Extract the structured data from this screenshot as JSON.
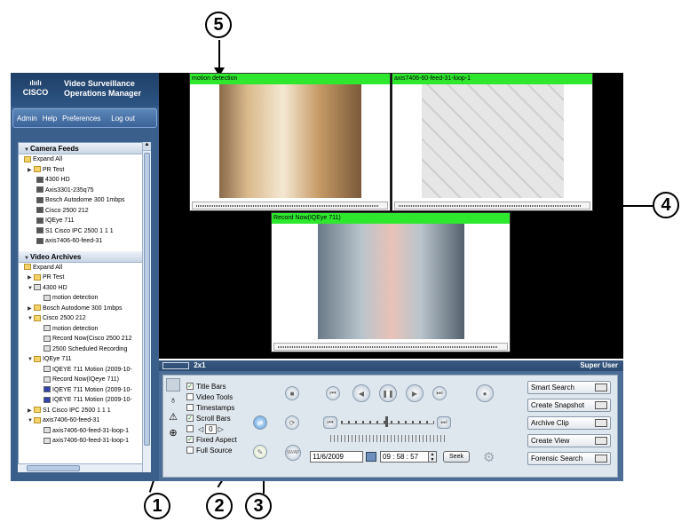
{
  "callouts": [
    "5",
    "4",
    "1",
    "2",
    "3"
  ],
  "brand": {
    "logo_bars": "ılıılı",
    "logo_text": "CISCO",
    "title_line1": "Video Surveillance",
    "title_line2": "Operations Manager"
  },
  "topnav": [
    "Admin",
    "Help",
    "Preferences",
    "Log out"
  ],
  "camera_feeds": {
    "header": "Camera Feeds",
    "items": [
      "Expand All",
      "PR Test",
      "4300 HD",
      "Axis3301-235q75",
      "Bosch Autodome 300 1mbps",
      "Cisco 2500 212",
      "IQEye 711",
      "S1 Cisco IPC 2500 1 1 1",
      "axis7406-60-feed-31"
    ]
  },
  "video_archives": {
    "header": "Video Archives",
    "items": [
      "Expand All",
      "PR Test",
      "4300 HD",
      "motion detection",
      "Bosch Autodome 300 1mbps",
      "Cisco 2500 212",
      "motion detection",
      "Record Now(Cisco 2500 212",
      "2500 Scheduled Recording",
      "IQEye 711",
      "IQEYE 711 Motion (2009-10-",
      "Record Now(IQeye 711)",
      "IQEYE 711 Motion (2009-10-",
      "IQEYE 711 Motion (2009-10-",
      "S1 Cisco IPC 2500 1 1 1",
      "axis7406-60-feed-31",
      "axis7406-60-feed-31-loop-1",
      "axis7406-60-feed-31-loop-1"
    ]
  },
  "panes": [
    {
      "title": "motion detection"
    },
    {
      "title": "axis7406-60-feed-31-loop-1"
    },
    {
      "title": "Record Now(IQEye 711)"
    }
  ],
  "controlbar": {
    "layout": "2x1",
    "user": "Super User"
  },
  "options": [
    "Title Bars",
    "Video Tools",
    "Timestamps",
    "Scroll Bars",
    "Fixed Aspect",
    "Full Source"
  ],
  "options_checked": [
    true,
    false,
    false,
    true,
    true,
    false
  ],
  "stepper_value": "0",
  "date": "11/6/2009",
  "time": "09 : 58 : 57",
  "seek_label": "Seek",
  "swap_label": "SWAP",
  "right_buttons": [
    "Smart Search",
    "Create Snapshot",
    "Archive Clip",
    "Create View",
    "Forensic Search"
  ]
}
